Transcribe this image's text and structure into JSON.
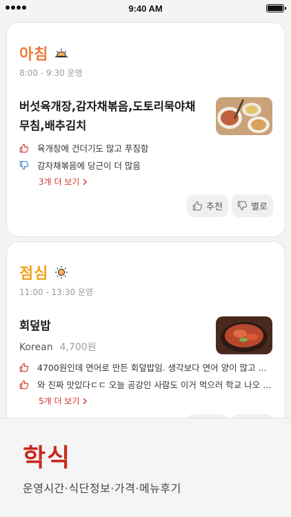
{
  "status_bar": {
    "time": "9:40 AM"
  },
  "meals": [
    {
      "title": "아침",
      "title_color": "#ec7a3a",
      "icon": "sunrise-icon",
      "hours": "8:00 - 9:30 운영",
      "menu": "버섯육개장,감자채볶음,도토리묵야채무침,배추김치",
      "reviews": [
        {
          "type": "like",
          "icon": "thumbs-up-icon",
          "text": "육개장에 건더기도 많고 푸짐함"
        },
        {
          "type": "dislike",
          "icon": "thumbs-down-icon",
          "text": "감자채볶음에 당근이 더 많음"
        }
      ],
      "more_label": "3개 더 보기",
      "recommend_label": "추천",
      "not_good_label": "별로"
    },
    {
      "title": "점심",
      "title_color": "#f0a21c",
      "icon": "sun-icon",
      "hours": "11:00 - 13:30 운영",
      "menu": "회덮밥",
      "category": "Korean",
      "price": "4,700원",
      "reviews": [
        {
          "type": "like",
          "icon": "thumbs-up-icon",
          "text": "4700원인데 연어로 만든 회덮밥임. 생각보다 연어 양이 많고 ..."
        },
        {
          "type": "like",
          "icon": "thumbs-up-icon",
          "text": "와 진짜 맛있다ㄷㄷ 오늘 공강인 사람도 이거 먹으러 학교 나오 ..."
        }
      ],
      "more_label": "5개 더 보기"
    }
  ],
  "app": {
    "title": "학식",
    "subtitle": "운영시간·식단정보·가격·메뉴후기",
    "accent_color": "#c8291f"
  }
}
